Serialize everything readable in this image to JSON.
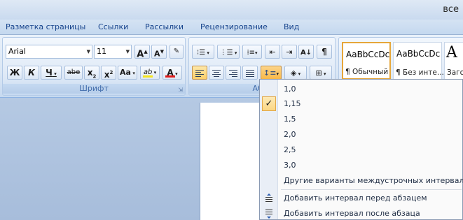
{
  "window": {
    "title": "все"
  },
  "tabs": [
    "Разметка страницы",
    "Ссылки",
    "Рассылки",
    "Рецензирование",
    "Вид"
  ],
  "font_group": {
    "label": "Шрифт",
    "font_name": "Arial",
    "font_size": "11",
    "grow_label": "A",
    "shrink_label": "A",
    "bold": "Ж",
    "italic": "К",
    "underline": "Ч",
    "strike": "abe",
    "subscript": "x",
    "subscript_mark": "2",
    "superscript": "x",
    "superscript_mark": "2",
    "case": "Aa",
    "highlight": "ab",
    "font_color": "A"
  },
  "paragraph_group": {
    "label": "Абза"
  },
  "styles_gallery": [
    {
      "sample": "AaBbCcDc",
      "name": "¶ Обычный"
    },
    {
      "sample": "AaBbCcDc",
      "name": "¶ Без инте..."
    },
    {
      "sample": "A",
      "name": "Заго"
    }
  ],
  "spacing_menu": {
    "items": [
      "1,0",
      "1,15",
      "1,5",
      "2,0",
      "2,5",
      "3,0"
    ],
    "checked": "1,15",
    "check_mark": "✓",
    "more_options": "Другие варианты междустрочных интервалов...",
    "add_before": "Добавить интервал перед абзацем",
    "add_after": "Добавить интервал после абзаца"
  },
  "colors": {
    "highlight_bar": "#f5e51c",
    "font_color_bar": "#e01b1b",
    "accent": "#15428b"
  }
}
